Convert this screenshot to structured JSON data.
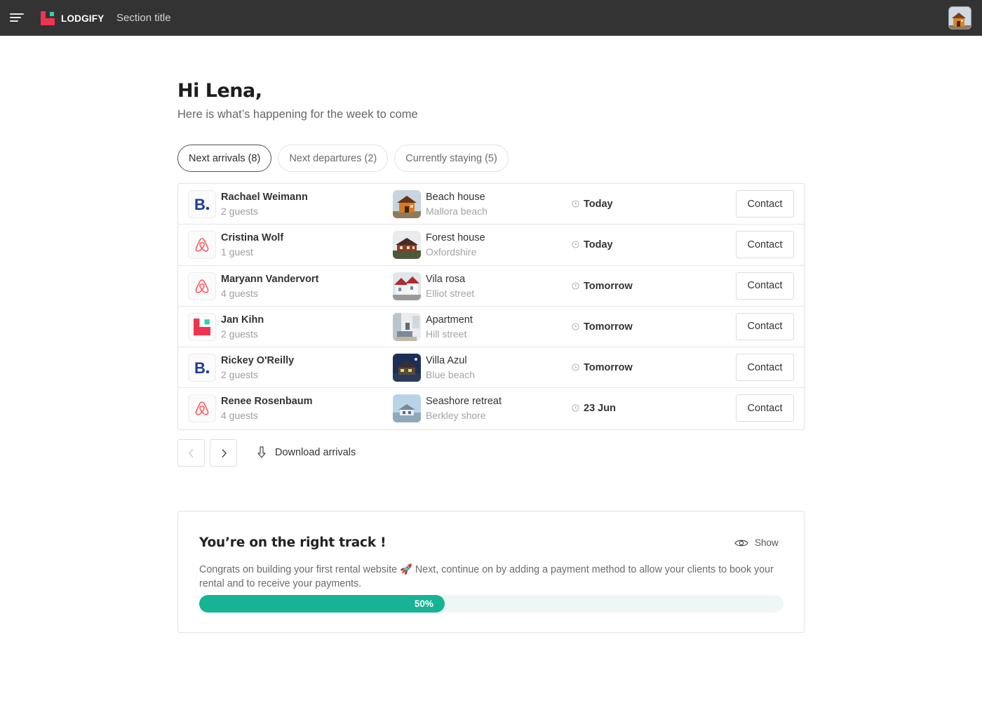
{
  "topbar": {
    "brand": "LODGIFY",
    "section_title": "Section title"
  },
  "header": {
    "greeting": "Hi Lena,",
    "subtitle": "Here is what’s happening for the week to come"
  },
  "tabs": [
    {
      "label": "Next arrivals (8)",
      "active": true
    },
    {
      "label": "Next departures (2)",
      "active": false
    },
    {
      "label": "Currently staying (5)",
      "active": false
    }
  ],
  "arrivals": [
    {
      "channel": "booking-icon",
      "guest": "Rachael Weimann",
      "guests": "2 guests",
      "property": "Beach house",
      "location": "Mallora beach",
      "when": "Today",
      "action": "Contact"
    },
    {
      "channel": "airbnb-icon",
      "guest": "Cristina Wolf",
      "guests": "1 guest",
      "property": "Forest house",
      "location": "Oxfordshire",
      "when": "Today",
      "action": "Contact"
    },
    {
      "channel": "airbnb-icon",
      "guest": "Maryann Vandervort",
      "guests": "4 guests",
      "property": "Vila rosa",
      "location": "Elliot street",
      "when": "Tomorrow",
      "action": "Contact"
    },
    {
      "channel": "lodgify-icon",
      "guest": "Jan Kihn",
      "guests": "2 guests",
      "property": "Apartment",
      "location": "Hill street",
      "when": "Tomorrow",
      "action": "Contact"
    },
    {
      "channel": "booking-icon",
      "guest": "Rickey O'Reilly",
      "guests": "2 guests",
      "property": "Villa Azul",
      "location": "Blue beach",
      "when": "Tomorrow",
      "action": "Contact"
    },
    {
      "channel": "airbnb-icon",
      "guest": "Renee Rosenbaum",
      "guests": "4 guests",
      "property": "Seashore retreat",
      "location": "Berkley shore",
      "when": "23 Jun",
      "action": "Contact"
    }
  ],
  "pagination": {
    "prev_icon": "chevron-left-icon",
    "next_icon": "chevron-right-icon",
    "download_label": "Download arrivals"
  },
  "progress_card": {
    "title": "You’re on the right track !",
    "toggle_label": "Show",
    "body": "Congrats on building your first rental website 🚀 Next, continue on by adding a payment method to allow your clients to book your rental and to receive your payments.",
    "progress_label": "50%",
    "progress_value": 0.42
  },
  "colors": {
    "topbar": "#333333",
    "brand_red": "#f0344f",
    "brand_teal": "#2ad4b2",
    "booking_blue": "#1b3c94",
    "airbnb_pink": "#ff5a5f",
    "progress": "#17b394"
  }
}
